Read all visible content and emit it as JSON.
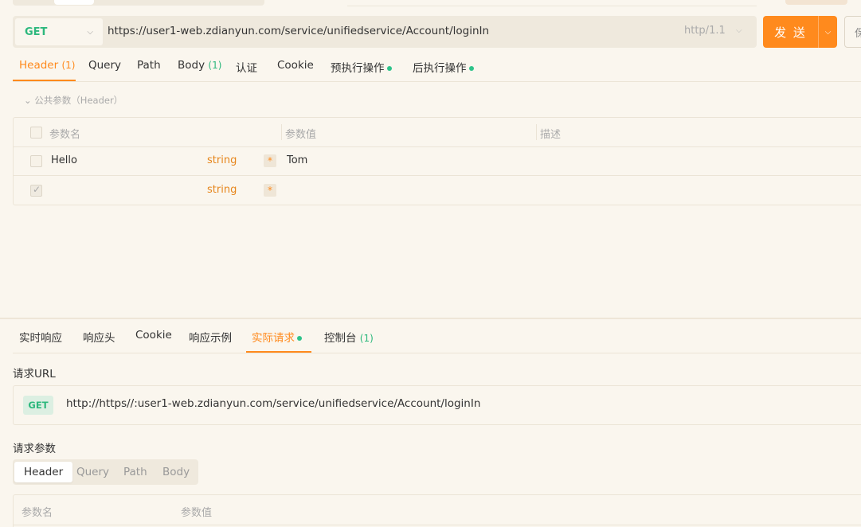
{
  "request": {
    "method": "GET",
    "url": "https://user1-web.zdianyun.com/service/unifiedservice/Account/loginIn",
    "protocol": "http/1.1",
    "send_label": "发 送",
    "save_label": "保"
  },
  "request_tabs": [
    {
      "label": "Header",
      "count": "(1)"
    },
    {
      "label": "Query",
      "count": ""
    },
    {
      "label": "Path",
      "count": ""
    },
    {
      "label": "Body",
      "count": "(1)"
    },
    {
      "label": "认证",
      "count": ""
    },
    {
      "label": "Cookie",
      "count": ""
    },
    {
      "label": "预执行操作",
      "count": ""
    },
    {
      "label": "后执行操作",
      "count": ""
    }
  ],
  "public_params_label": "公共参数（Header）",
  "header_table": {
    "columns": [
      "参数名",
      "参数值",
      "描述"
    ],
    "rows": [
      {
        "name": "Hello",
        "type": "string",
        "required": "*",
        "value": "Tom",
        "description": ""
      },
      {
        "name": "",
        "type": "string",
        "required": "*",
        "value": "",
        "description": ""
      }
    ]
  },
  "response_tabs": [
    {
      "label": "实时响应",
      "count": ""
    },
    {
      "label": "响应头",
      "count": ""
    },
    {
      "label": "Cookie",
      "count": ""
    },
    {
      "label": "响应示例",
      "count": ""
    },
    {
      "label": "实际请求",
      "count": ""
    },
    {
      "label": "控制台",
      "count": "(1)"
    }
  ],
  "actual_request": {
    "url_section_label": "请求URL",
    "method": "GET",
    "full_url": "http://https//:user1-web.zdianyun.com/service/unifiedservice/Account/loginIn",
    "params_section_label": "请求参数",
    "param_tabs": [
      "Header",
      "Query",
      "Path",
      "Body"
    ],
    "param_columns": [
      "参数名",
      "参数值"
    ]
  },
  "colors": {
    "accent": "#ff8a1d",
    "success": "#2db87d",
    "background": "#faf6ee"
  }
}
